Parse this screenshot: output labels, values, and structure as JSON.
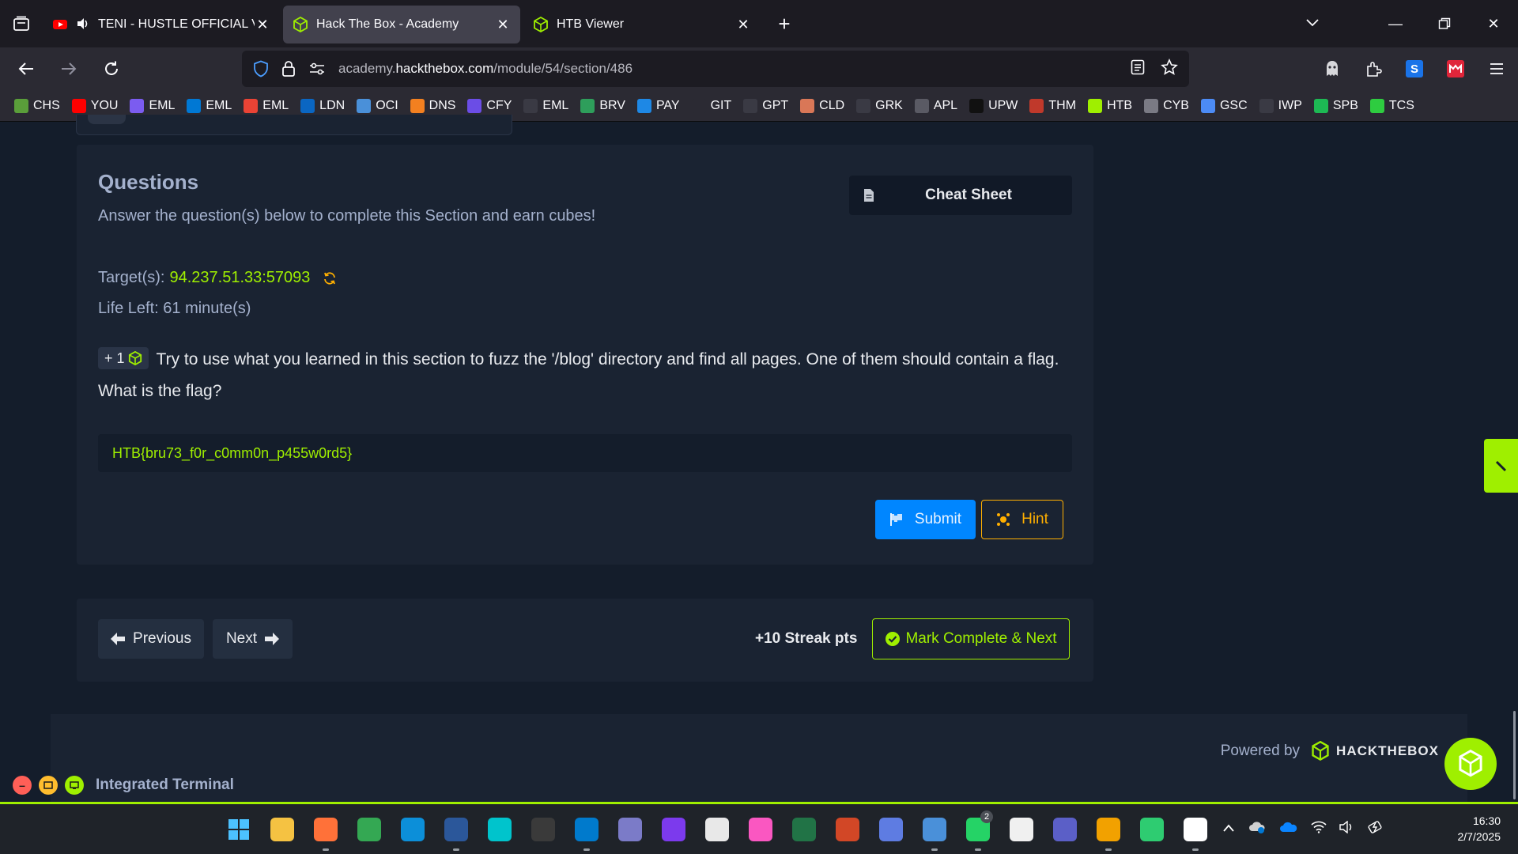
{
  "browser": {
    "tabs": [
      {
        "title": "TENI - HUSTLE OFFICIAL VIDEO",
        "active": false,
        "audio": true
      },
      {
        "title": "Hack The Box - Academy",
        "active": true
      },
      {
        "title": "HTB Viewer",
        "active": false
      }
    ],
    "url": {
      "prefix": "academy.",
      "domain": "hackthebox.com",
      "path": "/module/54/section/486"
    },
    "bookmarks": [
      {
        "label": "CHS",
        "color": "#5a9e3a"
      },
      {
        "label": "YOU",
        "color": "#ff0000"
      },
      {
        "label": "EML",
        "color": "#7b5cf0"
      },
      {
        "label": "EML",
        "color": "#0078d4"
      },
      {
        "label": "EML",
        "color": "#ea4335"
      },
      {
        "label": "LDN",
        "color": "#0a66c2"
      },
      {
        "label": "OCI",
        "color": "#4a90d9"
      },
      {
        "label": "DNS",
        "color": "#f38020"
      },
      {
        "label": "CFY",
        "color": "#6b4de6"
      },
      {
        "label": "EML",
        "color": "#3a3a44"
      },
      {
        "label": "BRV",
        "color": "#2e9e5b"
      },
      {
        "label": "PAY",
        "color": "#1e88e5"
      },
      {
        "label": "GIT",
        "color": "#2b2a33"
      },
      {
        "label": "GPT",
        "color": "#3a3a44"
      },
      {
        "label": "CLD",
        "color": "#d97757"
      },
      {
        "label": "GRK",
        "color": "#3a3a44"
      },
      {
        "label": "APL",
        "color": "#5a5a64"
      },
      {
        "label": "UPW",
        "color": "#111111"
      },
      {
        "label": "THM",
        "color": "#c0392b"
      },
      {
        "label": "HTB",
        "color": "#9fef00"
      },
      {
        "label": "CYB",
        "color": "#7a7a84"
      },
      {
        "label": "GSC",
        "color": "#4c8bf5"
      },
      {
        "label": "IWP",
        "color": "#3a3a44"
      },
      {
        "label": "SPB",
        "color": "#1db954"
      },
      {
        "label": "TCS",
        "color": "#2ecc40"
      }
    ]
  },
  "questions": {
    "title": "Questions",
    "subtitle": "Answer the question(s) below to complete this Section and earn cubes!",
    "cheat_sheet_label": "Cheat Sheet",
    "target_label": "Target(s):",
    "target_value": "94.237.51.33:57093",
    "life_left": "Life Left: 61 minute(s)",
    "cube_reward": "+ 1",
    "question_text": "Try to use what you learned in this section to fuzz the '/blog' directory and find all pages. One of them should contain a flag. What is the flag?",
    "answer_value": "HTB{bru73_f0r_c0mm0n_p455w0rd5}",
    "submit_label": "Submit",
    "hint_label": "Hint"
  },
  "section_nav": {
    "previous_label": "Previous",
    "next_label": "Next",
    "streak_label": "+10 Streak pts",
    "mark_complete_label": "Mark Complete & Next"
  },
  "footer": {
    "powered_by": "Powered by",
    "brand": "HACKTHEBOX",
    "terminal_label": "Integrated Terminal"
  },
  "taskbar": {
    "apps": [
      {
        "name": "start",
        "color": "#0078d4",
        "running": false
      },
      {
        "name": "file-explorer",
        "color": "#f5c242",
        "running": false
      },
      {
        "name": "firefox",
        "color": "#ff7139",
        "running": true
      },
      {
        "name": "chrome",
        "color": "#34a853",
        "running": false
      },
      {
        "name": "edge",
        "color": "#0c8fd9",
        "running": false
      },
      {
        "name": "word",
        "color": "#2b579a",
        "running": true
      },
      {
        "name": "canva",
        "color": "#00c4cc",
        "running": false
      },
      {
        "name": "terminal",
        "color": "#3a3a3a",
        "running": false
      },
      {
        "name": "vscode",
        "color": "#007acc",
        "running": true
      },
      {
        "name": "notepad",
        "color": "#7b7bc8",
        "running": false
      },
      {
        "name": "obsidian",
        "color": "#7c3aed",
        "running": false
      },
      {
        "name": "store",
        "color": "#e8e8e8",
        "running": false
      },
      {
        "name": "itunes",
        "color": "#fa57c1",
        "running": false
      },
      {
        "name": "excel",
        "color": "#217346",
        "running": false
      },
      {
        "name": "powerpoint",
        "color": "#d24726",
        "running": false
      },
      {
        "name": "vpn",
        "color": "#5e7ce2",
        "running": false
      },
      {
        "name": "notepad-plus",
        "color": "#4a90d9",
        "running": true
      },
      {
        "name": "whatsapp",
        "color": "#25d366",
        "running": true,
        "badge": "2"
      },
      {
        "name": "capcut",
        "color": "#f0f0f0",
        "running": false
      },
      {
        "name": "teams",
        "color": "#5b5fc7",
        "running": false
      },
      {
        "name": "remote-desktop",
        "color": "#f2a100",
        "running": true
      },
      {
        "name": "htb-app",
        "color": "#2ecc71",
        "running": false
      },
      {
        "name": "notion",
        "color": "#ffffff",
        "running": true
      }
    ],
    "time": "16:30",
    "date": "2/7/2025"
  }
}
